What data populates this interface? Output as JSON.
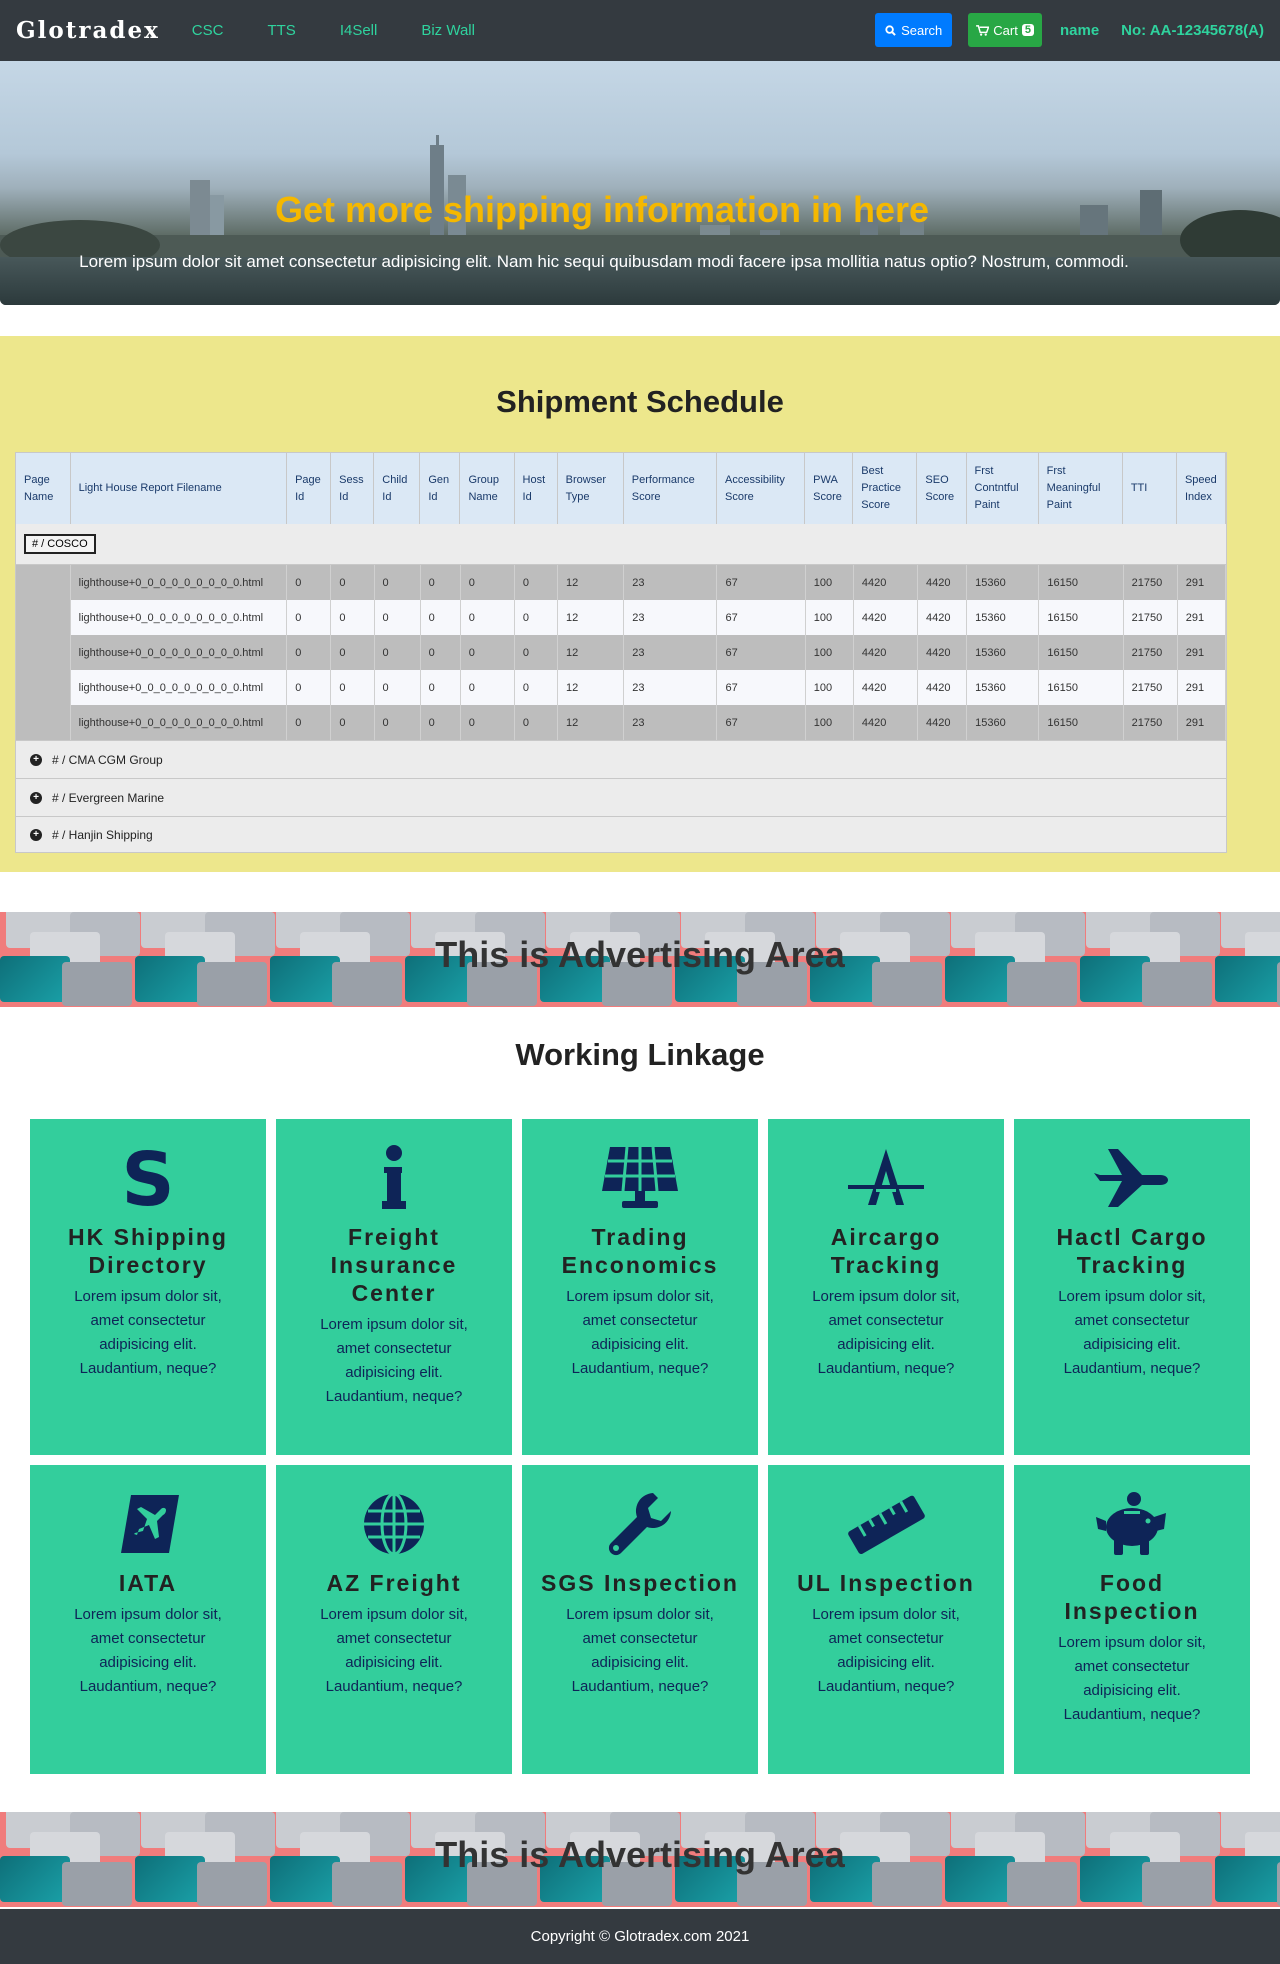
{
  "navbar": {
    "brand": "Glotradex",
    "links": [
      "CSC",
      "TTS",
      "I4Sell",
      "Biz Wall"
    ],
    "search_label": "Search",
    "cart_label": "Cart",
    "cart_count": "5",
    "user_name": "name",
    "account_no": "No: AA-12345678(A)"
  },
  "hero": {
    "title": "Get more shipping information in here",
    "text": "Lorem ipsum dolor sit amet consectetur adipisicing elit. Nam hic sequi quibusdam modi facere ipsa mollitia natus optio? Nostrum, commodi."
  },
  "schedule": {
    "title": "Shipment Schedule",
    "columns": [
      "Page Name",
      "Light House Report Filename",
      "Page Id",
      "Sess Id",
      "Child Id",
      "Gen Id",
      "Group Name",
      "Host Id",
      "Browser Type",
      "Performance Score",
      "Accessibility Score",
      "PWA Score",
      "Best Practice Score",
      "SEO Score",
      "Frst Contntful Paint",
      "Frst Meaningful Paint",
      "TTI",
      "Speed Index"
    ],
    "group_open": "# / COSCO",
    "rows": [
      [
        "lighthouse+0_0_0_0_0_0_0_0_0.html",
        "0",
        "0",
        "0",
        "0",
        "0",
        "0",
        "12",
        "23",
        "67",
        "100",
        "4420",
        "4420",
        "15360",
        "16150",
        "21750",
        "291"
      ],
      [
        "lighthouse+0_0_0_0_0_0_0_0_0.html",
        "0",
        "0",
        "0",
        "0",
        "0",
        "0",
        "12",
        "23",
        "67",
        "100",
        "4420",
        "4420",
        "15360",
        "16150",
        "21750",
        "291"
      ],
      [
        "lighthouse+0_0_0_0_0_0_0_0_0.html",
        "0",
        "0",
        "0",
        "0",
        "0",
        "0",
        "12",
        "23",
        "67",
        "100",
        "4420",
        "4420",
        "15360",
        "16150",
        "21750",
        "291"
      ],
      [
        "lighthouse+0_0_0_0_0_0_0_0_0.html",
        "0",
        "0",
        "0",
        "0",
        "0",
        "0",
        "12",
        "23",
        "67",
        "100",
        "4420",
        "4420",
        "15360",
        "16150",
        "21750",
        "291"
      ],
      [
        "lighthouse+0_0_0_0_0_0_0_0_0.html",
        "0",
        "0",
        "0",
        "0",
        "0",
        "0",
        "12",
        "23",
        "67",
        "100",
        "4420",
        "4420",
        "15360",
        "16150",
        "21750",
        "291"
      ]
    ],
    "groups_collapsed": [
      "# / CMA CGM Group",
      "# / Evergreen Marine",
      "# / Hanjin Shipping"
    ]
  },
  "ad": {
    "text": "This is Advertising Area"
  },
  "linkage": {
    "title": "Working Linkage",
    "tiles": [
      {
        "title": "HK Shipping Directory",
        "desc": "Lorem ipsum dolor sit, amet consectetur adipisicing elit. Laudantium, neque?",
        "icon": "dollar-s-icon"
      },
      {
        "title": "Freight Insurance Center",
        "desc": "Lorem ipsum dolor sit, amet consectetur adipisicing elit. Laudantium, neque?",
        "icon": "info-icon"
      },
      {
        "title": "Trading Enconomics",
        "desc": "Lorem ipsum dolor sit, amet consectetur adipisicing elit. Laudantium, neque?",
        "icon": "solar-panel-icon"
      },
      {
        "title": "Aircargo Tracking",
        "desc": "Lorem ipsum dolor sit, amet consectetur adipisicing elit. Laudantium, neque?",
        "icon": "a-logo-icon"
      },
      {
        "title": "Hactl Cargo Tracking",
        "desc": "Lorem ipsum dolor sit, amet consectetur adipisicing elit. Laudantium, neque?",
        "icon": "plane-icon"
      },
      {
        "title": "IATA",
        "desc": "Lorem ipsum dolor sit, amet consectetur adipisicing elit. Laudantium, neque?",
        "icon": "plane-square-icon"
      },
      {
        "title": "AZ Freight",
        "desc": "Lorem ipsum dolor sit, amet consectetur adipisicing elit. Laudantium, neque?",
        "icon": "globe-icon"
      },
      {
        "title": "SGS Inspection",
        "desc": "Lorem ipsum dolor sit, amet consectetur adipisicing elit. Laudantium, neque?",
        "icon": "wrench-icon"
      },
      {
        "title": "UL Inspection",
        "desc": "Lorem ipsum dolor sit, amet consectetur adipisicing elit. Laudantium, neque?",
        "icon": "ruler-icon"
      },
      {
        "title": "Food Inspection",
        "desc": "Lorem ipsum dolor sit, amet consectetur adipisicing elit. Laudantium, neque?",
        "icon": "piggy-bank-icon"
      }
    ]
  },
  "footer": {
    "text": "Copyright © Glotradex.com 2021"
  },
  "colors": {
    "navbar": "#343a40",
    "accent": "#2fd39e",
    "hero_title": "#f5b800",
    "schedule_bg": "#ede78c",
    "tile_bg": "#33ce9c",
    "ad_bg": "#f07c7c"
  }
}
